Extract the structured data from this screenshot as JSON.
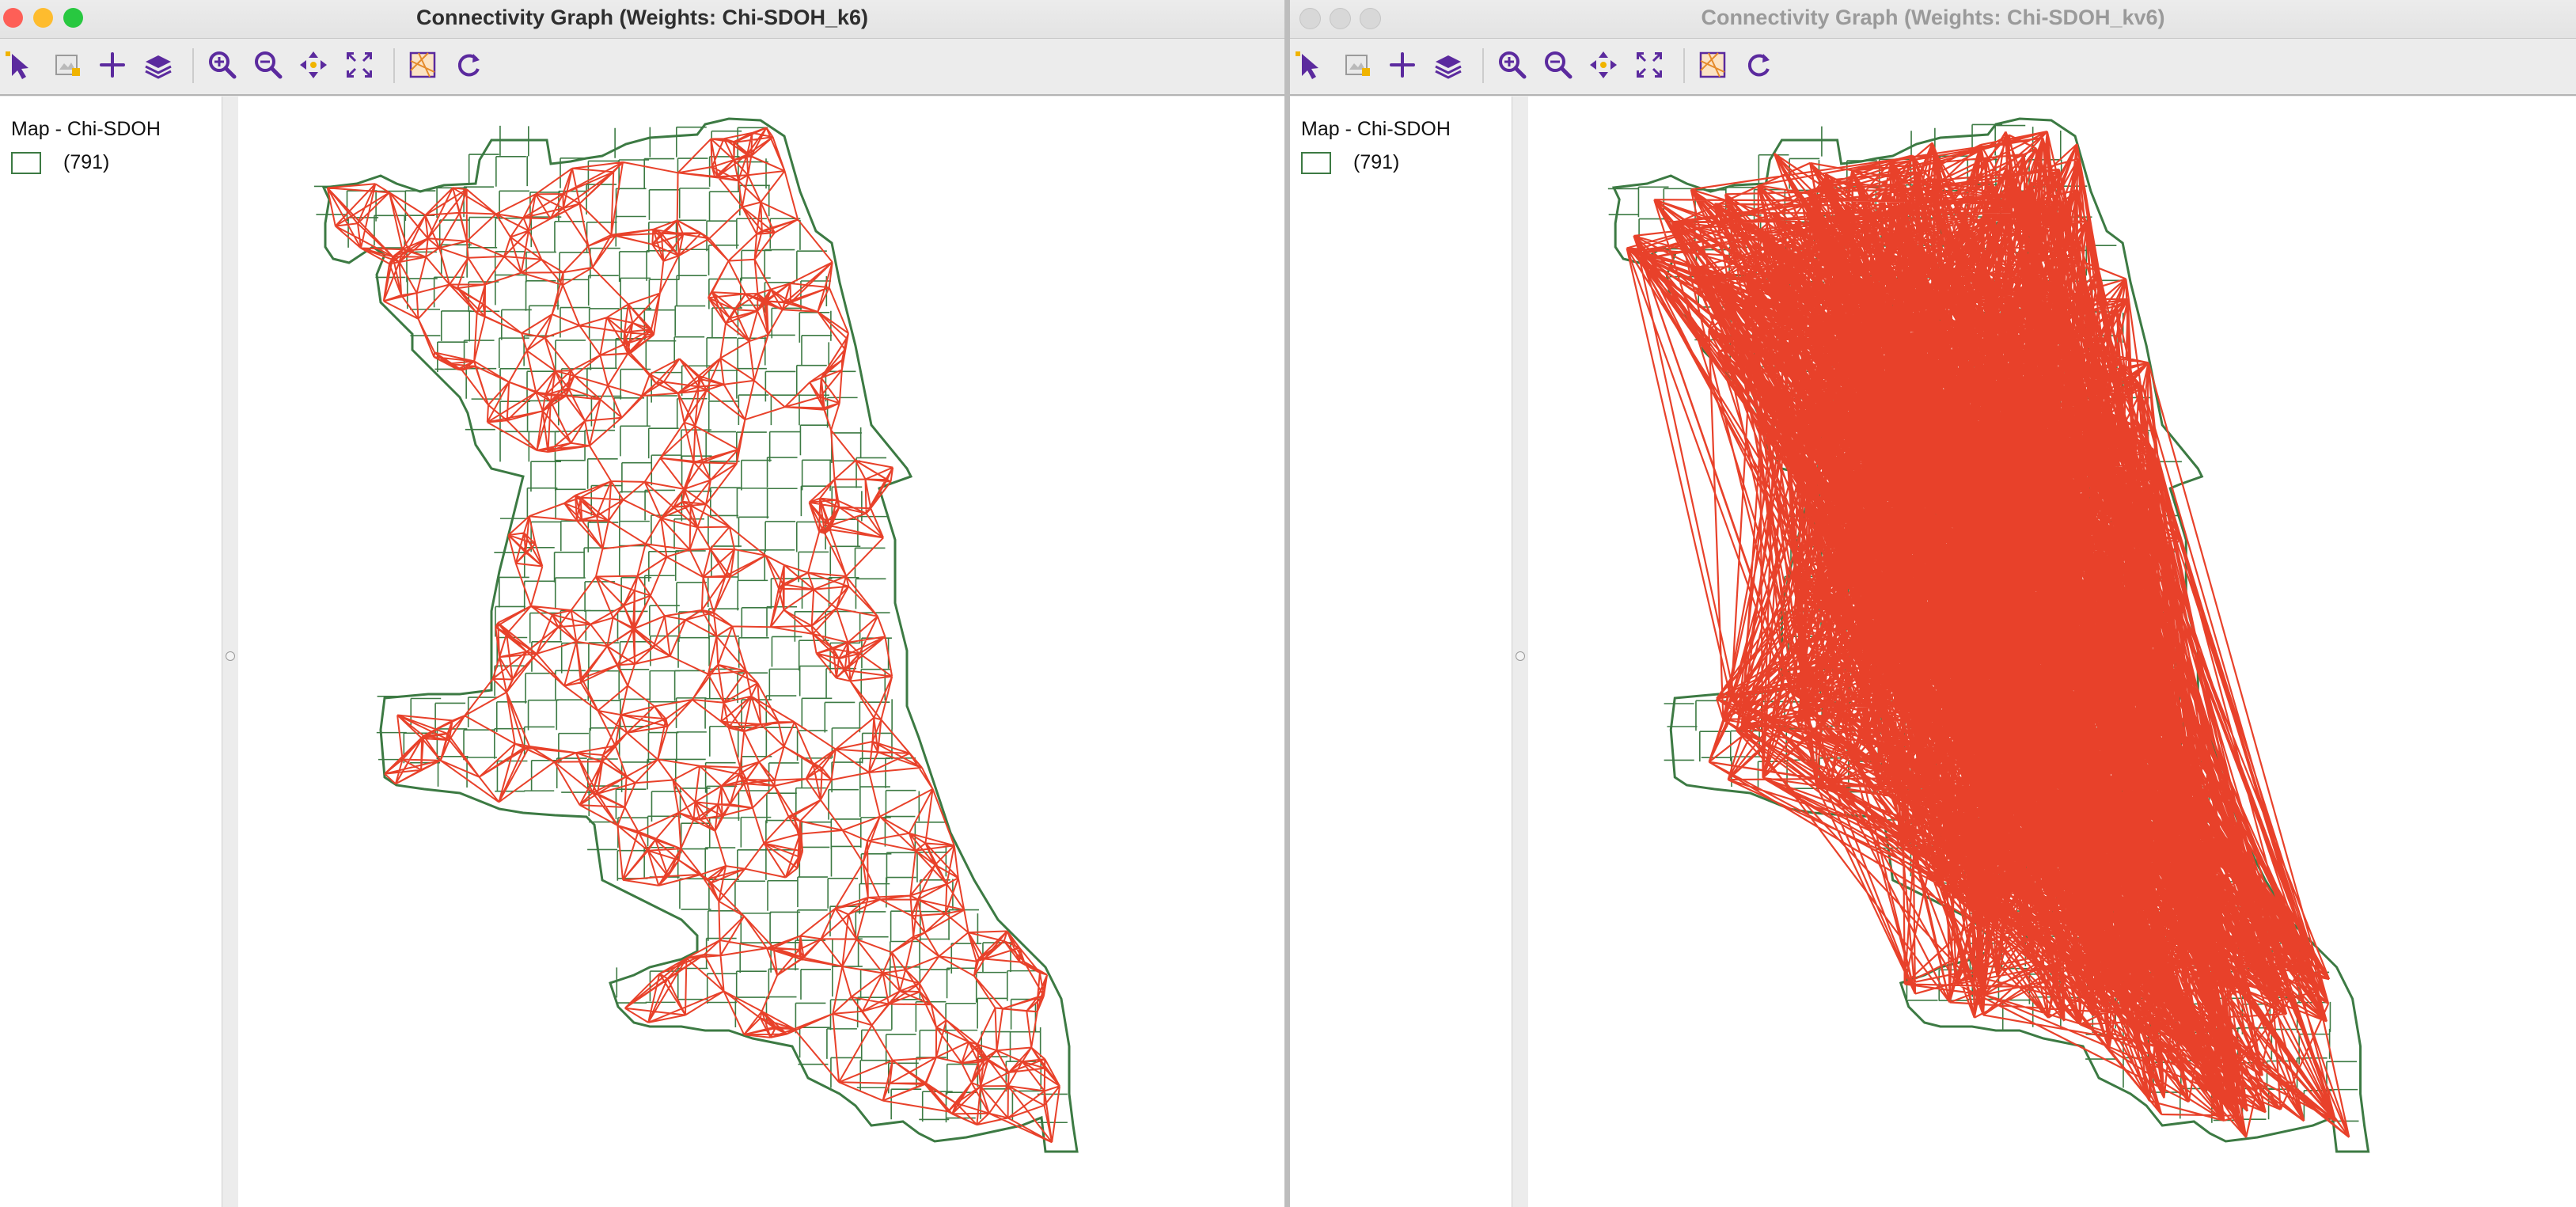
{
  "windows": [
    {
      "id": "left",
      "title": "Connectivity Graph (Weights: Chi-SDOH_k6)",
      "active": true,
      "legend": {
        "title": "Map - Chi-SDOH",
        "count": "(791)"
      }
    },
    {
      "id": "right",
      "title": "Connectivity Graph (Weights: Chi-SDOH_kv6)",
      "active": false,
      "legend": {
        "title": "Map - Chi-SDOH",
        "count": "(791)"
      }
    }
  ],
  "toolbar": {
    "icons": [
      "select-pointer-icon",
      "map-layer-toggle-icon",
      "add-layer-icon",
      "layers-stack-icon",
      "zoom-in-icon",
      "zoom-out-icon",
      "pan-icon",
      "full-extent-icon",
      "basemap-icon",
      "refresh-icon"
    ]
  },
  "colors": {
    "edge": "#e8412a",
    "boundary": "#3c7a43",
    "toolbar_icon": "#5b2a9e",
    "close": "#fe5f57",
    "minimize": "#febc2e",
    "zoom": "#28c840",
    "inactive_light": "#d8d8d8"
  }
}
